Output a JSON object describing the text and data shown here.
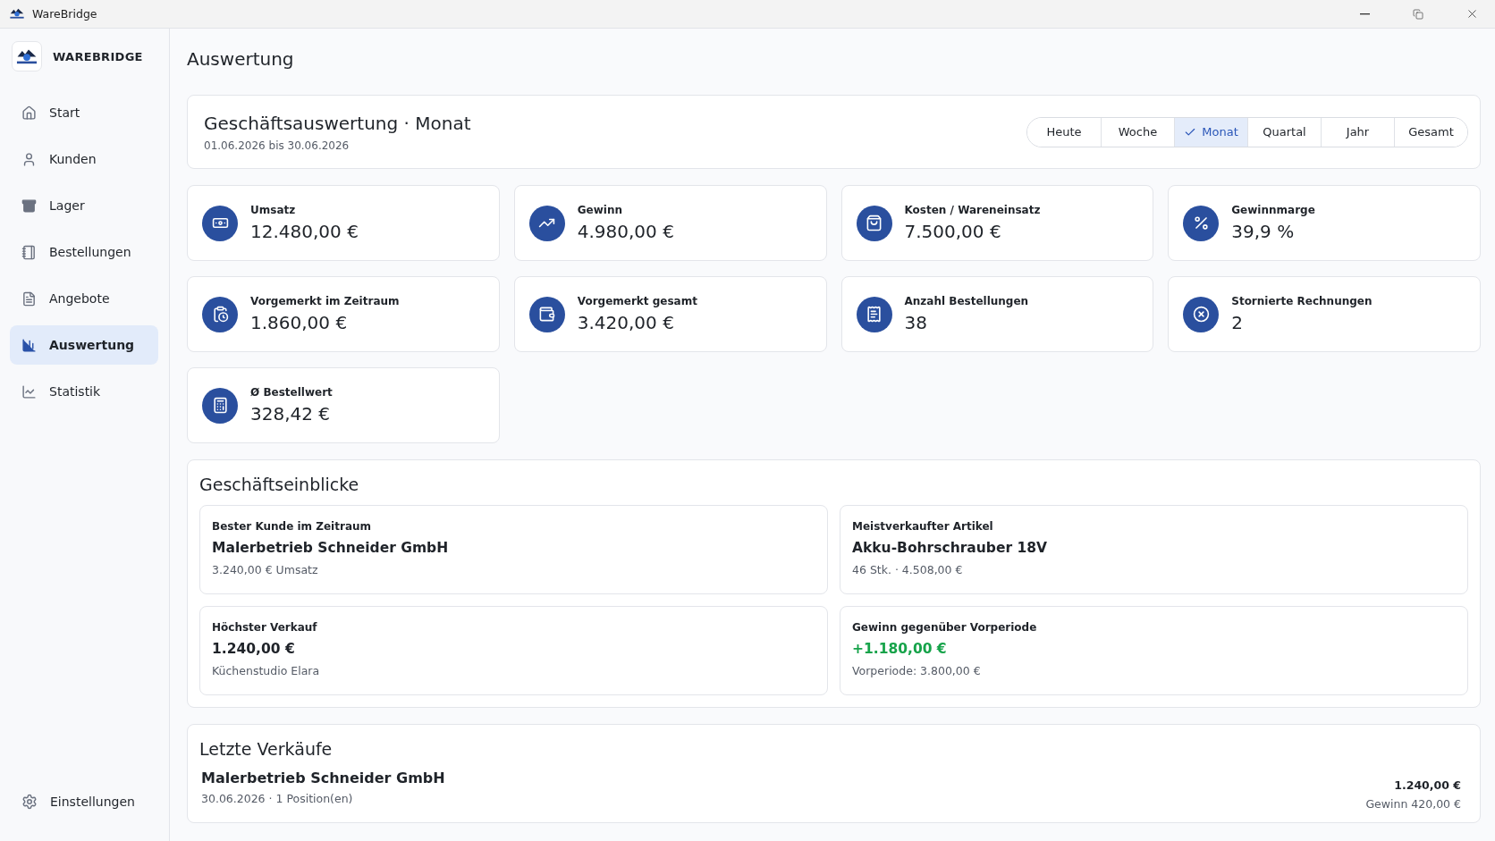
{
  "window": {
    "title": "WareBridge"
  },
  "sidebar": {
    "brand": "WAREBRIDGE",
    "items": [
      {
        "label": "Start",
        "selected": false
      },
      {
        "label": "Kunden",
        "selected": false
      },
      {
        "label": "Lager",
        "selected": false
      },
      {
        "label": "Bestellungen",
        "selected": false
      },
      {
        "label": "Angebote",
        "selected": false
      },
      {
        "label": "Auswertung",
        "selected": true
      },
      {
        "label": "Statistik",
        "selected": false
      }
    ],
    "footer_item": {
      "label": "Einstellungen",
      "selected": false
    }
  },
  "page_title": "Auswertung",
  "header": {
    "title": "Geschäftsauswertung · Monat",
    "range": "01.06.2026 bis 30.06.2026",
    "periods": [
      {
        "label": "Heute",
        "selected": false
      },
      {
        "label": "Woche",
        "selected": false
      },
      {
        "label": "Monat",
        "selected": true
      },
      {
        "label": "Quartal",
        "selected": false
      },
      {
        "label": "Jahr",
        "selected": false
      },
      {
        "label": "Gesamt",
        "selected": false
      }
    ]
  },
  "kpis": [
    {
      "label": "Umsatz",
      "value": "12.480,00 €"
    },
    {
      "label": "Gewinn",
      "value": "4.980,00 €"
    },
    {
      "label": "Kosten / Wareneinsatz",
      "value": "7.500,00 €"
    },
    {
      "label": "Gewinnmarge",
      "value": "39,9 %"
    },
    {
      "label": "Vorgemerkt im Zeitraum",
      "value": "1.860,00 €"
    },
    {
      "label": "Vorgemerkt gesamt",
      "value": "3.420,00 €"
    },
    {
      "label": "Anzahl Bestellungen",
      "value": "38"
    },
    {
      "label": "Stornierte Rechnungen",
      "value": "2"
    },
    {
      "label": "Ø Bestellwert",
      "value": "328,42 €"
    }
  ],
  "insights": {
    "title": "Geschäftseinblicke",
    "cards": [
      {
        "label": "Bester Kunde im Zeitraum",
        "value": "Malerbetrieb Schneider GmbH",
        "detail": "3.240,00 € Umsatz",
        "color": "#1f2329"
      },
      {
        "label": "Meistverkaufter Artikel",
        "value": "Akku-Bohrschrauber 18V",
        "detail": "46 Stk. · 4.508,00 €",
        "color": "#1f2329"
      },
      {
        "label": "Höchster Verkauf",
        "value": "1.240,00 €",
        "detail": "Küchenstudio Elara",
        "color": "#1f2329"
      },
      {
        "label": "Gewinn gegenüber Vorperiode",
        "value": "+1.180,00 €",
        "detail": "Vorperiode: 3.800,00 €",
        "color": "#16a34a"
      }
    ]
  },
  "recent_sales": {
    "title": "Letzte Verkäufe",
    "rows": [
      {
        "customer": "Malerbetrieb Schneider GmbH",
        "meta": "30.06.2026 · 1 Position(en)",
        "amount": "1.240,00 €",
        "profit": "Gewinn 420,00 €"
      }
    ]
  }
}
